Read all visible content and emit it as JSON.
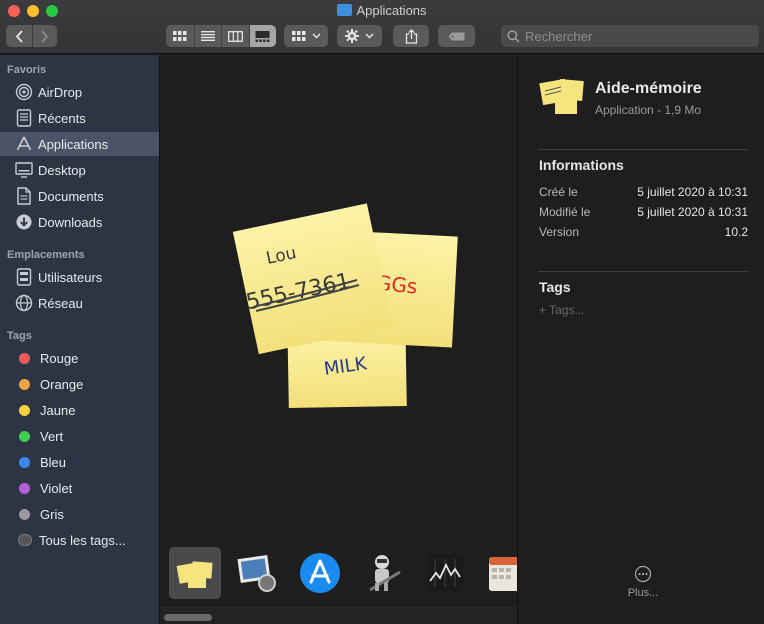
{
  "window": {
    "title": "Applications"
  },
  "toolbar": {
    "back_icon": "chevron-left-icon",
    "forward_icon": "chevron-right-icon",
    "view_modes": [
      "icon-view",
      "list-view",
      "column-view",
      "gallery-view"
    ],
    "active_view": "gallery-view",
    "search_placeholder": "Rechercher"
  },
  "sidebar": {
    "favorites_title": "Favoris",
    "favorites": [
      {
        "label": "AirDrop",
        "icon": "airdrop-icon"
      },
      {
        "label": "Récents",
        "icon": "clock-icon"
      },
      {
        "label": "Applications",
        "icon": "applications-icon",
        "selected": true
      },
      {
        "label": "Desktop",
        "icon": "desktop-icon"
      },
      {
        "label": "Documents",
        "icon": "document-icon"
      },
      {
        "label": "Downloads",
        "icon": "download-icon"
      }
    ],
    "locations_title": "Emplacements",
    "locations": [
      {
        "label": "Utilisateurs",
        "icon": "server-icon"
      },
      {
        "label": "Réseau",
        "icon": "network-icon"
      }
    ],
    "tags_title": "Tags",
    "tags": [
      {
        "label": "Rouge",
        "color": "#f25957"
      },
      {
        "label": "Orange",
        "color": "#f3a33f"
      },
      {
        "label": "Jaune",
        "color": "#f5d33f"
      },
      {
        "label": "Vert",
        "color": "#3fcf4f"
      },
      {
        "label": "Bleu",
        "color": "#3b87f0"
      },
      {
        "label": "Violet",
        "color": "#b45fd8"
      },
      {
        "label": "Gris",
        "color": "#9a9a9c"
      },
      {
        "label": "Tous les tags..."
      }
    ]
  },
  "preview": {
    "notes": [
      {
        "lines": [
          "Lou",
          "555-7361"
        ]
      },
      {
        "lines": [
          "EGGs"
        ]
      },
      {
        "lines": [
          "MILK"
        ]
      }
    ],
    "thumbnails": [
      "stickies-icon",
      "preview-app-icon",
      "app-store-icon",
      "automator-icon",
      "stocks-icon",
      "calendar-icon"
    ]
  },
  "info": {
    "app_name": "Aide-mémoire",
    "app_kind": "Application - 1,9 Mo",
    "informations_title": "Informations",
    "rows": [
      {
        "label": "Créé le",
        "value": "5 juillet 2020 à 10:31"
      },
      {
        "label": "Modifié le",
        "value": "5 juillet 2020 à 10:31"
      },
      {
        "label": "Version",
        "value": "10.2"
      }
    ],
    "tags_title": "Tags",
    "tags_placeholder": "+ Tags...",
    "more_label": "Plus..."
  }
}
